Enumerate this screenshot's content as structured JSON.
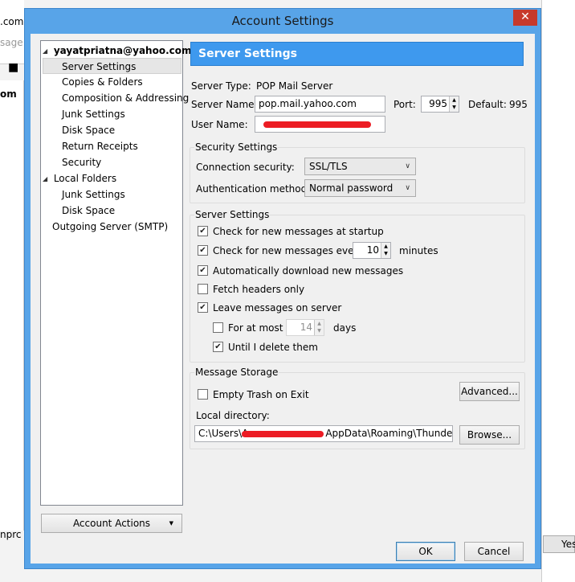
{
  "background": {
    "top_left_text": ".com",
    "search_hint": "sage",
    "left_text_1": "om",
    "left_text_2": "nprc",
    "right_button": "Yes"
  },
  "dialog": {
    "title": "Account Settings",
    "close_glyph": "✕"
  },
  "tree": {
    "items": [
      {
        "label": "yayatpriatna@yahoo.com",
        "level": 0,
        "expanded": true,
        "bold": true
      },
      {
        "label": "Server Settings",
        "level": 1,
        "selected": true
      },
      {
        "label": "Copies & Folders",
        "level": 1
      },
      {
        "label": "Composition & Addressing",
        "level": 1
      },
      {
        "label": "Junk Settings",
        "level": 1
      },
      {
        "label": "Disk Space",
        "level": 1
      },
      {
        "label": "Return Receipts",
        "level": 1
      },
      {
        "label": "Security",
        "level": 1
      },
      {
        "label": "Local Folders",
        "level": 0,
        "expanded": true
      },
      {
        "label": "Junk Settings",
        "level": 1
      },
      {
        "label": "Disk Space",
        "level": 1
      },
      {
        "label": "Outgoing Server (SMTP)",
        "level": 0
      }
    ],
    "account_actions": "Account Actions"
  },
  "panel": {
    "header": "Server Settings",
    "server_type_label": "Server Type:",
    "server_type_value": "POP Mail Server",
    "server_name_label": "Server Name:",
    "server_name_value": "pop.mail.yahoo.com",
    "port_label": "Port:",
    "port_value": "995",
    "default_label": "Default:",
    "default_value": "995",
    "user_name_label": "User Name:",
    "user_name_value": ""
  },
  "security": {
    "title": "Security Settings",
    "connection_label": "Connection security:",
    "connection_value": "SSL/TLS",
    "auth_label": "Authentication method:",
    "auth_value": "Normal password"
  },
  "server_settings": {
    "title": "Server Settings",
    "check_startup": {
      "label": "Check for new messages at startup",
      "checked": true
    },
    "check_every": {
      "label": "Check for new messages every",
      "checked": true,
      "value": "10",
      "unit": "minutes"
    },
    "auto_download": {
      "label": "Automatically download new messages",
      "checked": true
    },
    "fetch_headers": {
      "label": "Fetch headers only",
      "checked": false
    },
    "leave_on_server": {
      "label": "Leave messages on server",
      "checked": true
    },
    "for_at_most": {
      "label": "For at most",
      "checked": false,
      "value": "14",
      "unit": "days"
    },
    "until_delete": {
      "label": "Until I delete them",
      "checked": true
    }
  },
  "storage": {
    "title": "Message Storage",
    "empty_trash": {
      "label": "Empty Trash on Exit",
      "checked": false
    },
    "advanced_button": "Advanced...",
    "local_dir_label": "Local directory:",
    "local_dir_prefix": "C:\\Users\\A",
    "local_dir_suffix": "AppData\\Roaming\\Thunderbi",
    "browse_button": "Browse..."
  },
  "footer": {
    "ok": "OK",
    "cancel": "Cancel"
  }
}
